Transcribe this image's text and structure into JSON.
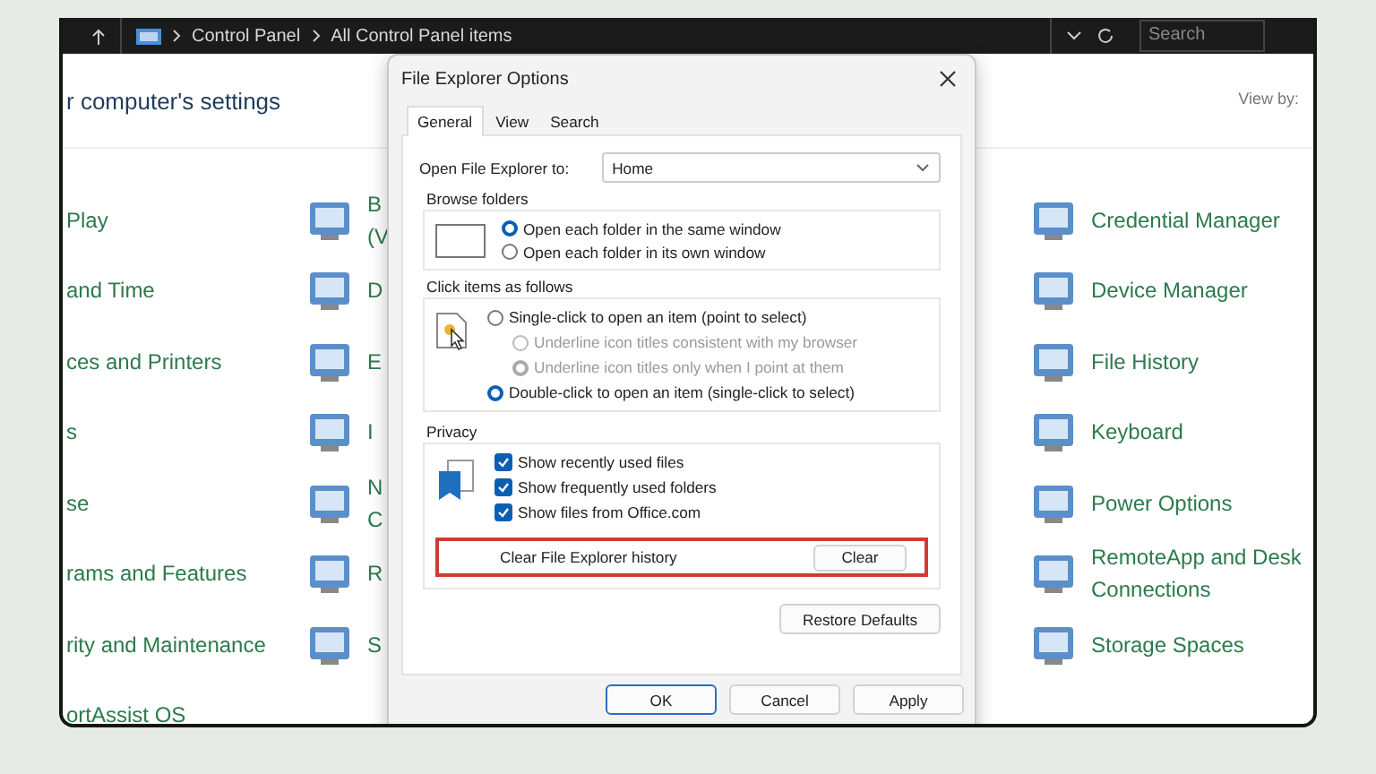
{
  "address_bar": {
    "path": [
      "Control Panel",
      "All Control Panel items"
    ],
    "search_placeholder": "Search"
  },
  "header": {
    "title": "r computer's settings",
    "view_by": "View by:"
  },
  "columns": [
    [
      {
        "lines": [
          "Play"
        ]
      },
      {
        "lines": [
          "and Time"
        ]
      },
      {
        "lines": [
          "ces and Printers"
        ]
      },
      {
        "lines": [
          "s"
        ]
      },
      {
        "lines": [
          "se"
        ]
      },
      {
        "lines": [
          "rams and Features"
        ]
      },
      {
        "lines": [
          "rity and Maintenance"
        ]
      },
      {
        "lines": [
          "ortAssist OS"
        ]
      }
    ],
    [
      {
        "lines": [
          "B",
          "(V"
        ]
      },
      {
        "lines": [
          "D"
        ]
      },
      {
        "lines": [
          "E"
        ]
      },
      {
        "lines": [
          "I"
        ]
      },
      {
        "lines": [
          "N",
          "C"
        ]
      },
      {
        "lines": [
          "R"
        ]
      },
      {
        "lines": [
          "S"
        ]
      }
    ],
    [
      {
        "lines": [
          "Credential Manager"
        ]
      },
      {
        "lines": [
          "Device Manager"
        ]
      },
      {
        "lines": [
          "File History"
        ]
      },
      {
        "lines": [
          "Keyboard"
        ]
      },
      {
        "lines": [
          "Power Options"
        ]
      },
      {
        "lines": [
          "RemoteApp and Desk",
          "Connections"
        ]
      },
      {
        "lines": [
          "Storage Spaces"
        ]
      }
    ]
  ],
  "dialog": {
    "title": "File Explorer Options",
    "tabs": [
      {
        "label": "General",
        "selected": true
      },
      {
        "label": "View",
        "selected": false
      },
      {
        "label": "Search",
        "selected": false
      }
    ],
    "open_to": {
      "label": "Open File Explorer to:",
      "value": "Home"
    },
    "browse_folders": {
      "title": "Browse folders",
      "options": [
        {
          "label": "Open each folder in the same window",
          "selected": true,
          "disabled": false
        },
        {
          "label": "Open each folder in its own window",
          "selected": false,
          "disabled": false
        }
      ]
    },
    "click_items": {
      "title": "Click items as follows",
      "options": [
        {
          "label": "Single-click to open an item (point to select)",
          "selected": false,
          "disabled": false,
          "children": [
            {
              "label": "Underline icon titles consistent with my browser",
              "selected": false,
              "disabled": true
            },
            {
              "label": "Underline icon titles only when I point at them",
              "selected": true,
              "disabled": true
            }
          ]
        },
        {
          "label": "Double-click to open an item (single-click to select)",
          "selected": true,
          "disabled": false
        }
      ]
    },
    "privacy": {
      "title": "Privacy",
      "options": [
        {
          "label": "Show recently used files",
          "checked": true
        },
        {
          "label": "Show frequently used folders",
          "checked": true
        },
        {
          "label": "Show files from Office.com",
          "checked": true
        }
      ],
      "clear_label": "Clear File Explorer history",
      "clear_button": "Clear",
      "highlighted": true
    },
    "restore_button": "Restore Defaults",
    "buttons": [
      {
        "label": "OK",
        "default": true
      },
      {
        "label": "Cancel",
        "default": false
      },
      {
        "label": "Apply",
        "default": false
      }
    ]
  }
}
